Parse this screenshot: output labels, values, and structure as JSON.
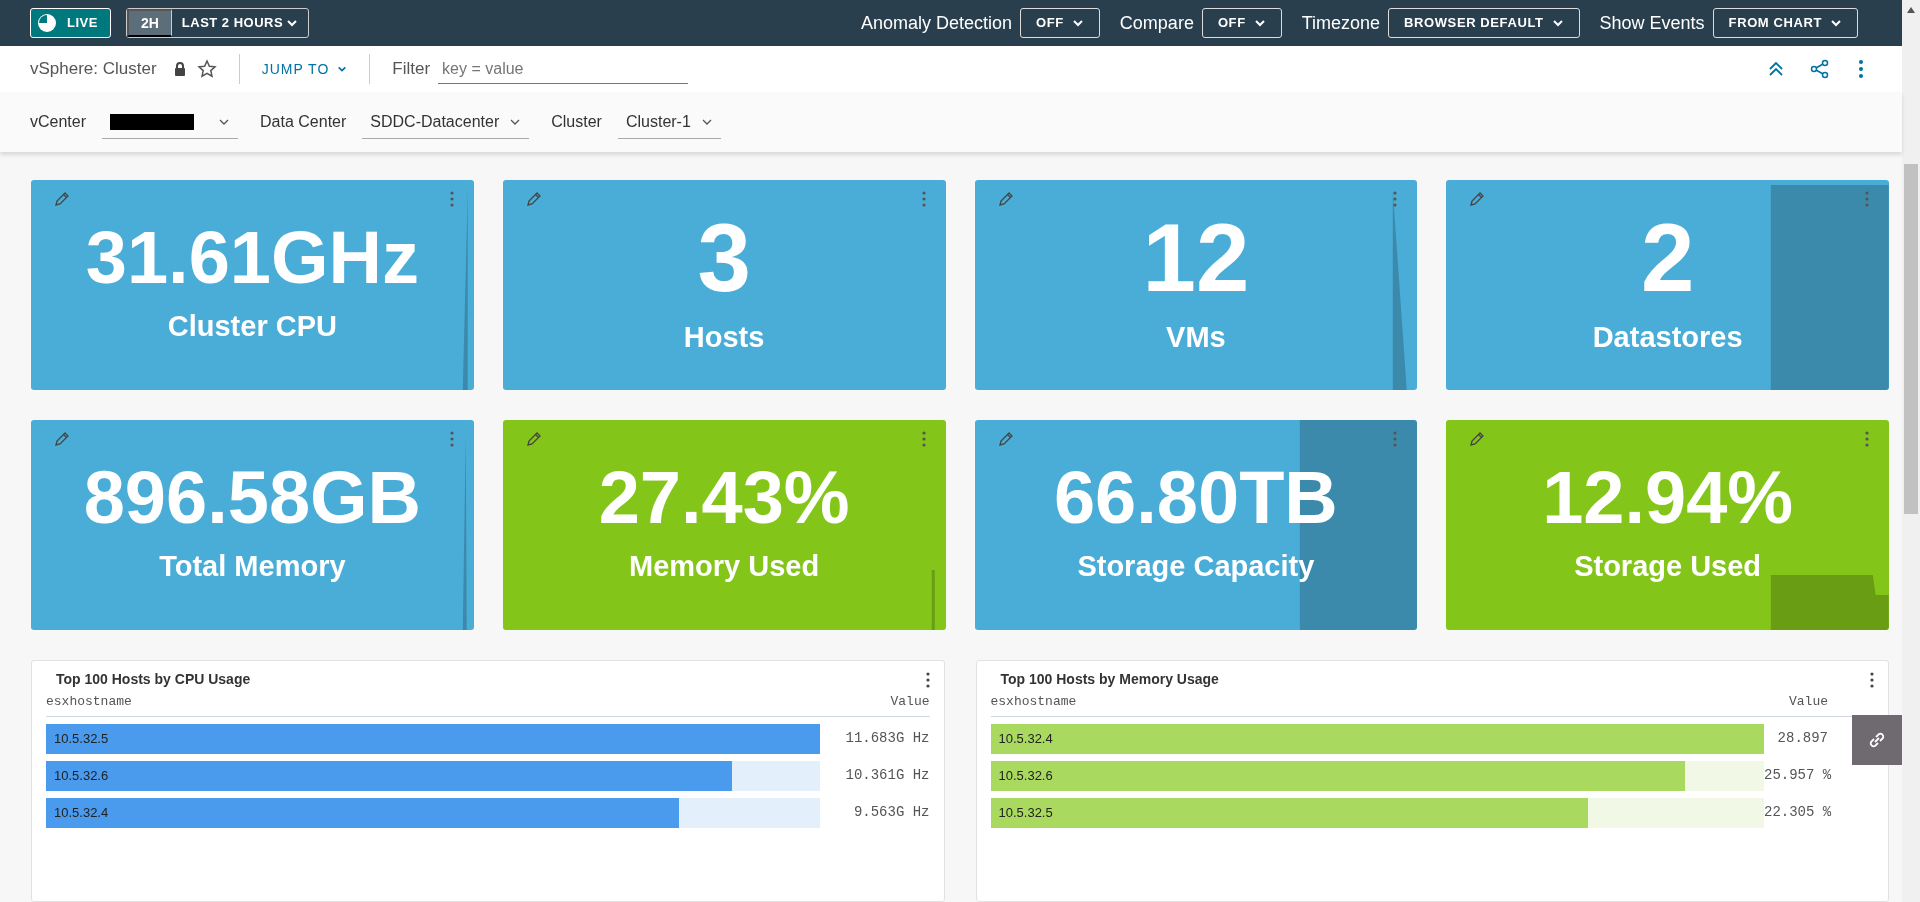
{
  "top_bar": {
    "live": "LIVE",
    "time_short": "2H",
    "time_range": "LAST 2 HOURS",
    "controls": [
      {
        "label": "Anomaly Detection",
        "value": "OFF"
      },
      {
        "label": "Compare",
        "value": "OFF"
      },
      {
        "label": "Timezone",
        "value": "BROWSER DEFAULT"
      },
      {
        "label": "Show Events",
        "value": "FROM CHART"
      }
    ]
  },
  "header": {
    "title": "vSphere: Cluster",
    "jump_to": "JUMP TO",
    "filter": {
      "label": "Filter",
      "placeholder": "key = value"
    }
  },
  "scope": [
    {
      "label": "vCenter",
      "kind": "redacted"
    },
    {
      "label": "Data Center",
      "kind": "select",
      "value": "SDDC-Datacenter"
    },
    {
      "label": "Cluster",
      "kind": "select",
      "value": "Cluster-1"
    }
  ],
  "tiles": [
    {
      "value": "31.61GHz",
      "label": "Cluster CPU",
      "color": "#4aadd8"
    },
    {
      "value": "3",
      "label": "Hosts",
      "color": "#4aadd8"
    },
    {
      "value": "12",
      "label": "VMs",
      "color": "#4aadd8"
    },
    {
      "value": "2",
      "label": "Datastores",
      "color": "#4aadd8"
    },
    {
      "value": "896.58GB",
      "label": "Total Memory",
      "color": "#4aadd8"
    },
    {
      "value": "27.43%",
      "label": "Memory Used",
      "color": "#84c51a"
    },
    {
      "value": "66.80TB",
      "label": "Storage Capacity",
      "color": "#4aadd8"
    },
    {
      "value": "12.94%",
      "label": "Storage Used",
      "color": "#84c51a"
    }
  ],
  "tables": [
    {
      "title": "Top 100 Hosts by CPU Usage",
      "color": "#4a9aee",
      "columns": [
        "esxhostname",
        "Value"
      ],
      "rows": [
        {
          "host": "10.5.32.5",
          "value": "11.683G Hz",
          "level": 1.0
        },
        {
          "host": "10.5.32.6",
          "value": "10.361G Hz",
          "level": 0.887
        },
        {
          "host": "10.5.32.4",
          "value": "9.563G Hz",
          "level": 0.819
        }
      ]
    },
    {
      "title": "Top 100 Hosts by Memory Usage",
      "color": "#a9d95e",
      "columns": [
        "esxhostname",
        "Value"
      ],
      "rows": [
        {
          "host": "10.5.32.4",
          "value": "28.897",
          "level": 1.0
        },
        {
          "host": "10.5.32.6",
          "value": "25.957 %",
          "level": 0.898
        },
        {
          "host": "10.5.32.5",
          "value": "22.305 %",
          "level": 0.772
        }
      ]
    }
  ]
}
